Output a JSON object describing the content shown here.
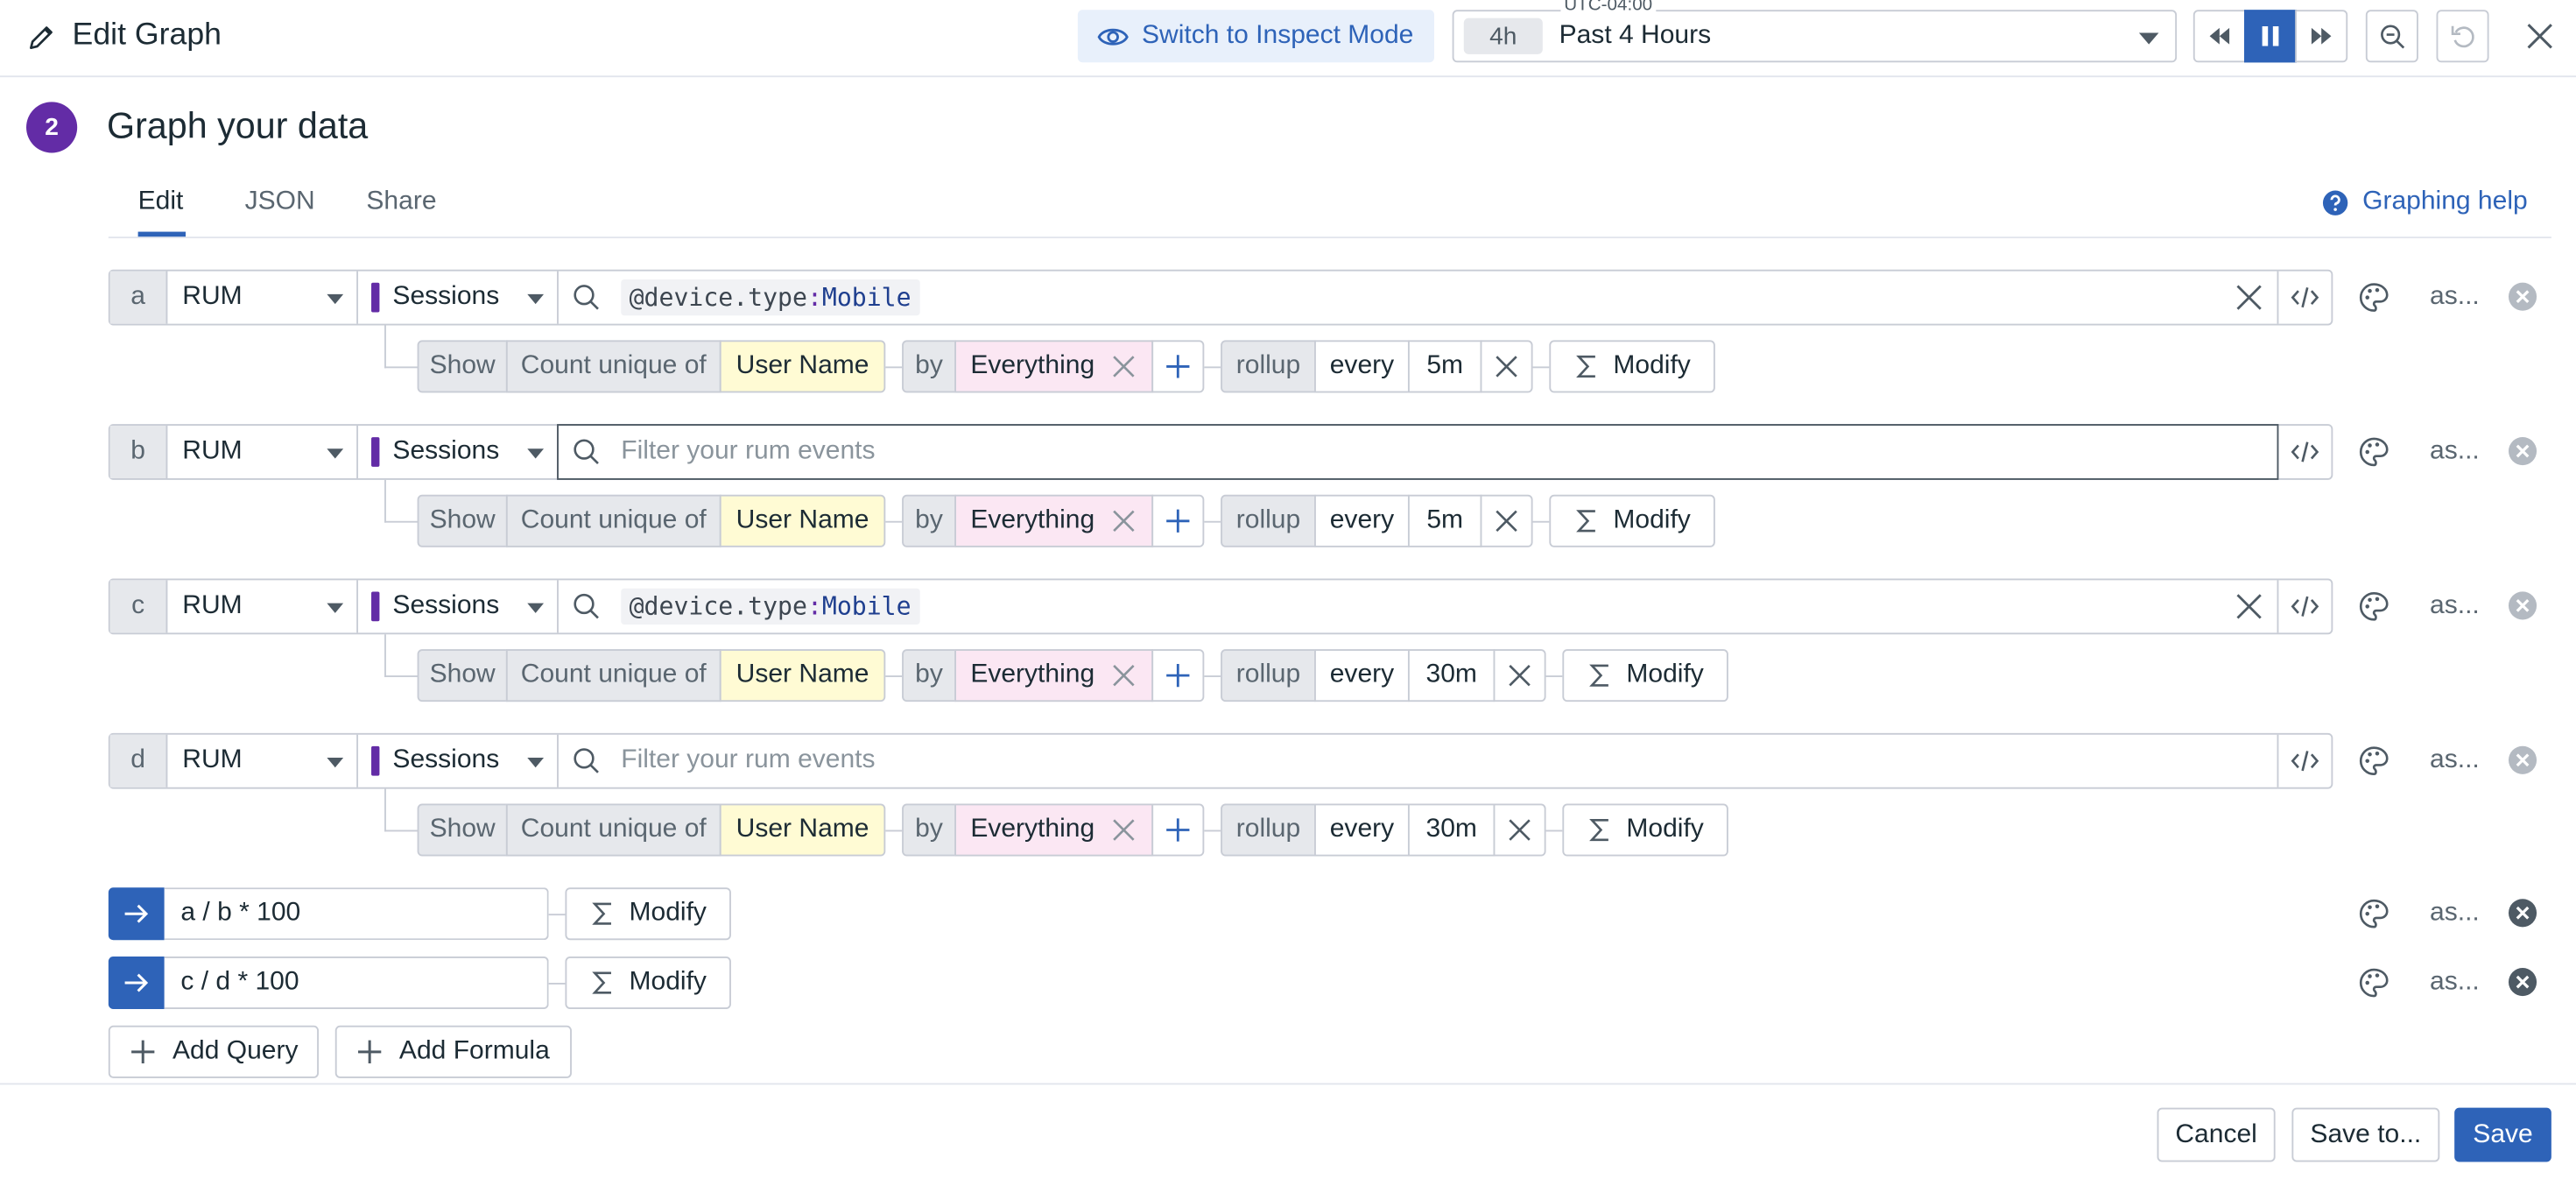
{
  "header": {
    "title": "Edit Graph",
    "inspect_label": "Switch to Inspect Mode",
    "timezone": "UTC-04:00",
    "time_badge": "4h",
    "time_label": "Past 4 Hours"
  },
  "step": {
    "number": "2",
    "title": "Graph your data"
  },
  "tabs": [
    {
      "label": "Edit"
    },
    {
      "label": "JSON"
    },
    {
      "label": "Share"
    }
  ],
  "help_label": "Graphing help",
  "queries": [
    {
      "letter": "a",
      "datasource": "RUM",
      "source": "Sessions",
      "filter_key": "@device.type",
      "filter_sep": ":",
      "filter_value": "Mobile",
      "placeholder": "",
      "show": "Show",
      "agg": "Count unique of",
      "measure": "User Name",
      "by": "by",
      "group": "Everything",
      "rollup": "rollup",
      "every": "every",
      "interval": "5m",
      "modify": "Modify",
      "alias": "as..."
    },
    {
      "letter": "b",
      "datasource": "RUM",
      "source": "Sessions",
      "filter_key": "",
      "filter_sep": "",
      "filter_value": "",
      "placeholder": "Filter your rum events",
      "show": "Show",
      "agg": "Count unique of",
      "measure": "User Name",
      "by": "by",
      "group": "Everything",
      "rollup": "rollup",
      "every": "every",
      "interval": "5m",
      "modify": "Modify",
      "alias": "as..."
    },
    {
      "letter": "c",
      "datasource": "RUM",
      "source": "Sessions",
      "filter_key": "@device.type",
      "filter_sep": ":",
      "filter_value": "Mobile",
      "placeholder": "",
      "show": "Show",
      "agg": "Count unique of",
      "measure": "User Name",
      "by": "by",
      "group": "Everything",
      "rollup": "rollup",
      "every": "every",
      "interval": "30m",
      "modify": "Modify",
      "alias": "as..."
    },
    {
      "letter": "d",
      "datasource": "RUM",
      "source": "Sessions",
      "filter_key": "",
      "filter_sep": "",
      "filter_value": "",
      "placeholder": "Filter your rum events",
      "show": "Show",
      "agg": "Count unique of",
      "measure": "User Name",
      "by": "by",
      "group": "Everything",
      "rollup": "rollup",
      "every": "every",
      "interval": "30m",
      "modify": "Modify",
      "alias": "as..."
    }
  ],
  "formulas": [
    {
      "expression": "a / b * 100",
      "modify": "Modify",
      "alias": "as..."
    },
    {
      "expression": "c / d * 100",
      "modify": "Modify",
      "alias": "as..."
    }
  ],
  "actions": {
    "add_query": "Add Query",
    "add_formula": "Add Formula"
  },
  "footer": {
    "cancel": "Cancel",
    "save_to": "Save to...",
    "save": "Save"
  },
  "colors": {
    "accent": "#2e63b8",
    "purple": "#632ca6",
    "measure_bg": "#fffbd4",
    "group_bg": "#fbe7f3"
  },
  "icons": [
    "pencil-icon",
    "eye-icon",
    "rewind-icon",
    "pause-icon",
    "fast-forward-icon",
    "zoom-out-icon",
    "undo-icon",
    "close-icon",
    "help-icon",
    "search-icon",
    "clear-icon",
    "code-icon",
    "palette-icon",
    "remove-icon",
    "plus-icon",
    "sigma-icon",
    "arrow-right-icon"
  ]
}
